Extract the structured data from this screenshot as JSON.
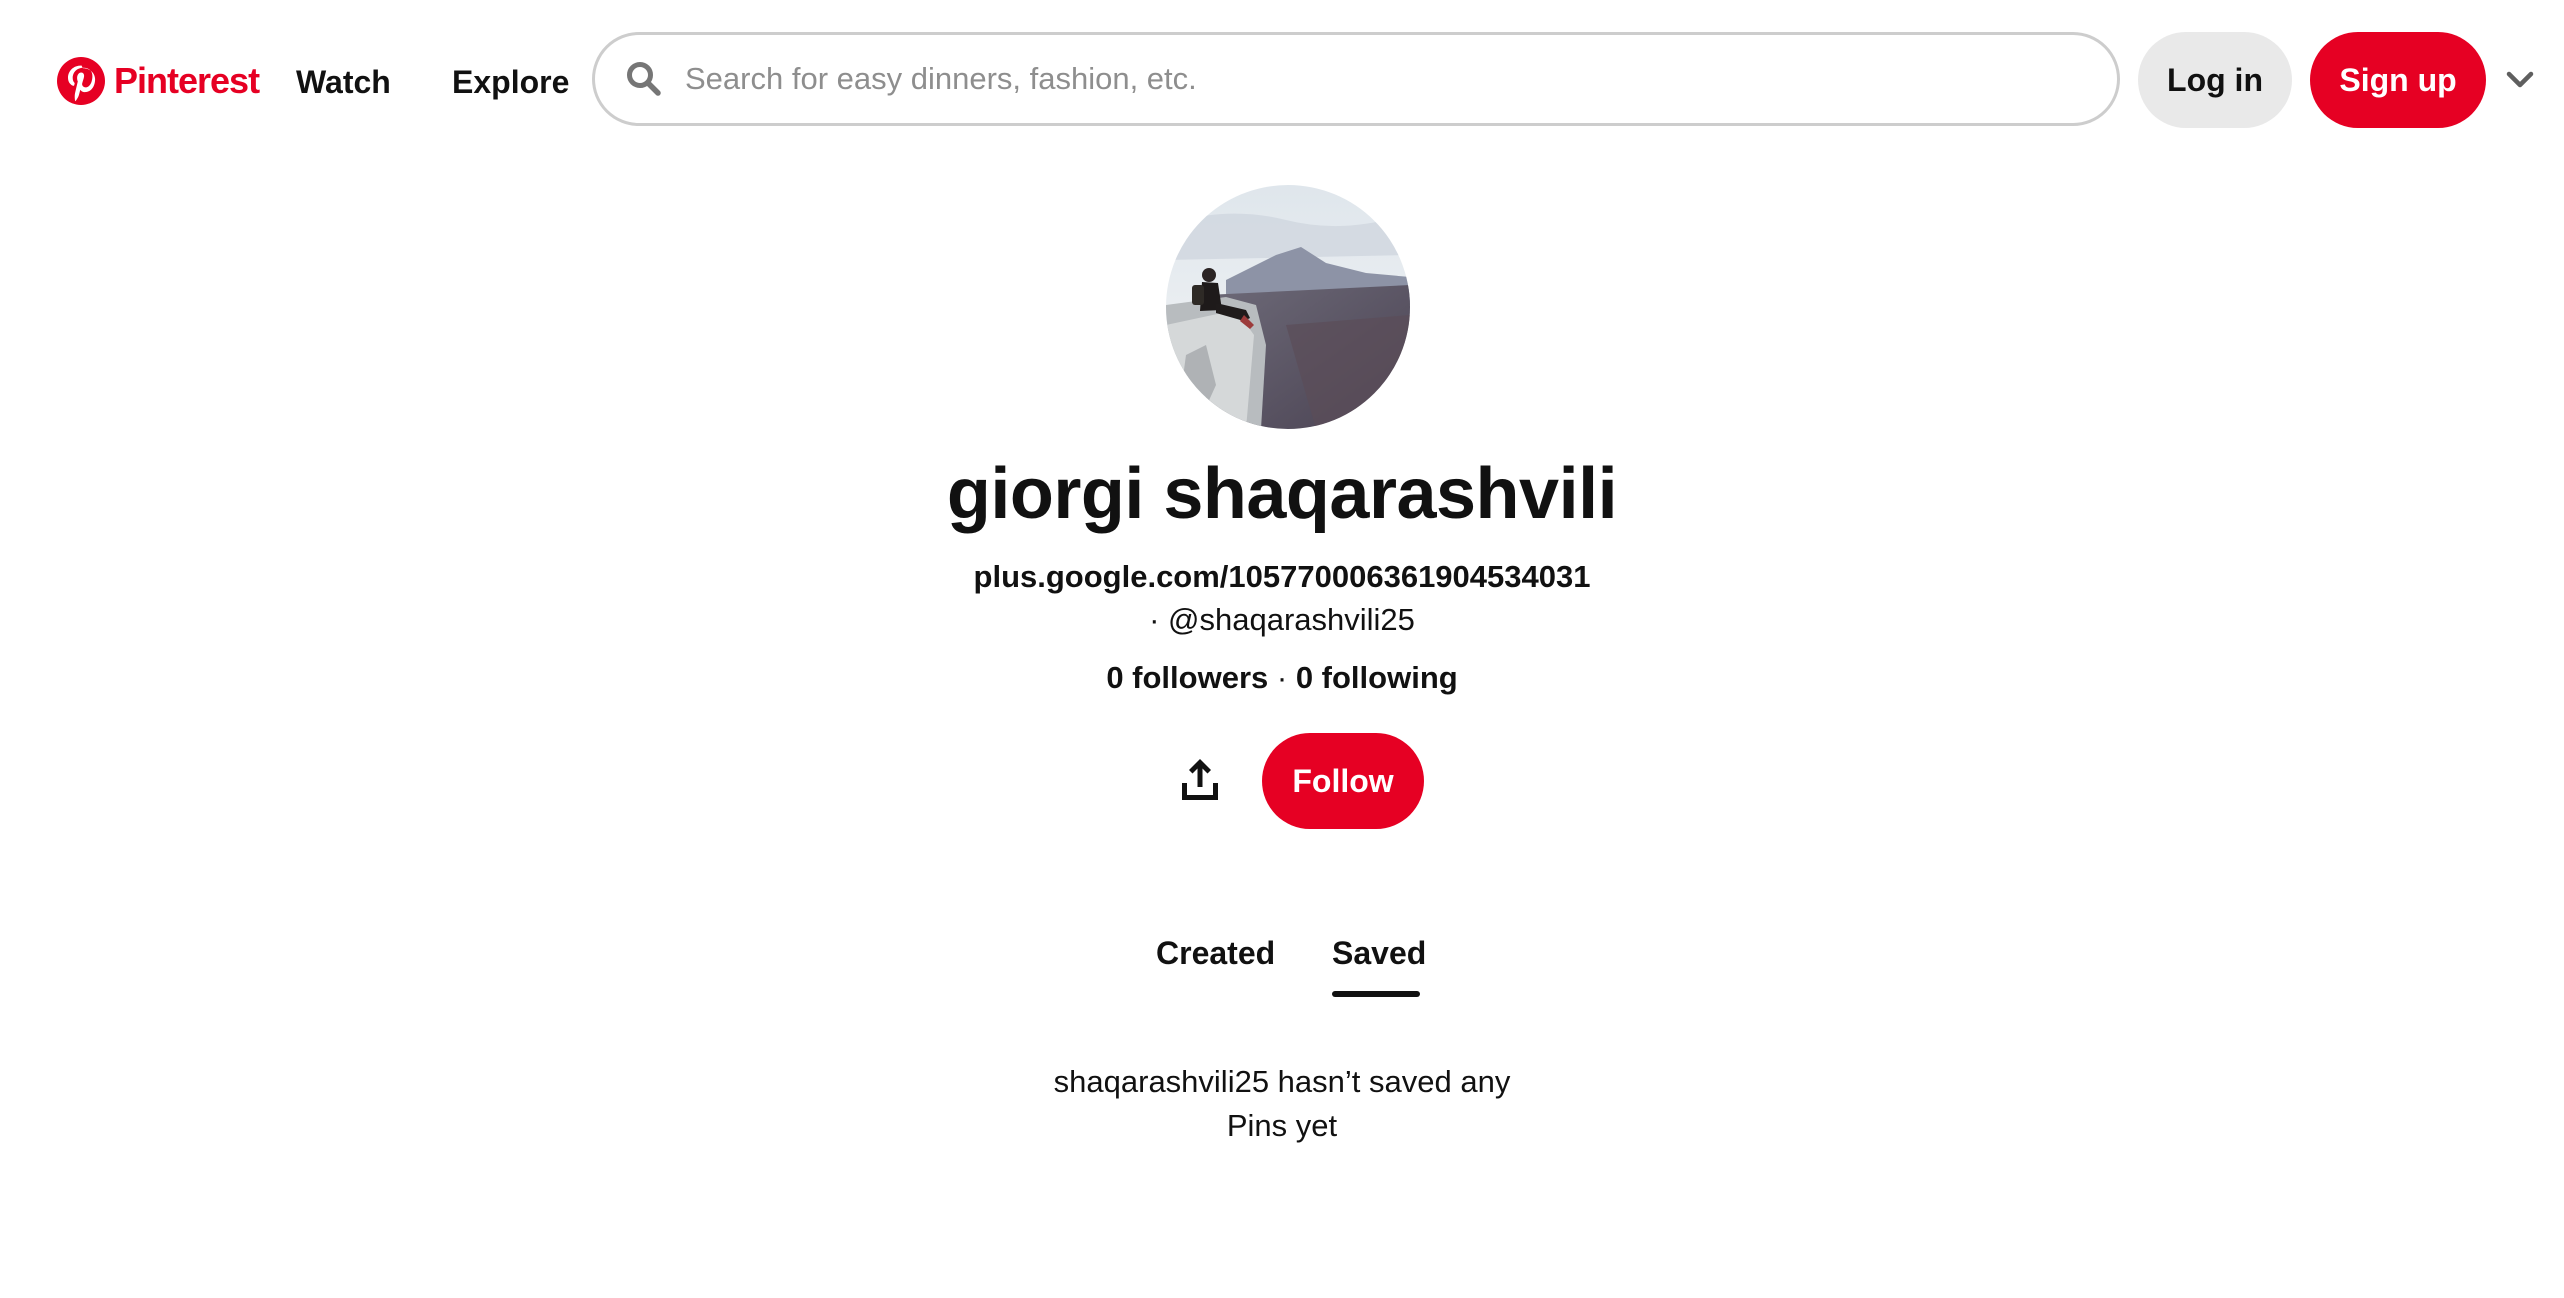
{
  "header": {
    "brand": "Pinterest",
    "brand_color": "#e60023",
    "nav": {
      "watch": "Watch",
      "explore": "Explore"
    },
    "search": {
      "placeholder": "Search for easy dinners, fashion, etc.",
      "value": ""
    },
    "login_label": "Log in",
    "signup_label": "Sign up",
    "icons": {
      "logo": "pinterest-logo-icon",
      "search": "search-icon",
      "menu": "chevron-down-icon"
    }
  },
  "profile": {
    "name": "giorgi shaqarashvili",
    "website": "plus.google.com/105770006361904534031",
    "handle_prefix": "· ",
    "handle": "@shaqarashvili25",
    "followers": "0 followers",
    "separator": " · ",
    "following": "0 following",
    "follow_label": "Follow",
    "share_icon": "share-icon"
  },
  "tabs": [
    {
      "label": "Created",
      "active": false
    },
    {
      "label": "Saved",
      "active": true
    }
  ],
  "empty_state": {
    "line1": "shaqarashvili25 hasn’t saved any",
    "line2": "Pins yet"
  }
}
